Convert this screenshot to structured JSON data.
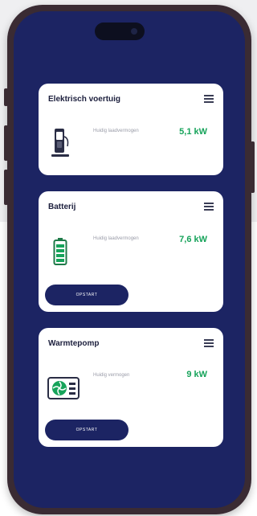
{
  "cards": [
    {
      "title": "Elektrisch voertuig",
      "description": "Huidig laadvermogen",
      "value": "5,1 kW",
      "icon": "ev-charger-icon",
      "button": ""
    },
    {
      "title": "Batterij",
      "description": "Huidig laadvermogen",
      "value": "7,6 kW",
      "icon": "battery-icon",
      "button": "OPSTART"
    },
    {
      "title": "Warmtepomp",
      "description": "Huidig vermogen",
      "value": "9 kW",
      "icon": "heat-pump-icon",
      "button": "OPSTART"
    }
  ],
  "colors": {
    "screen_background": "#1c2463",
    "value_green": "#16a35a",
    "button_navy": "#1c2463"
  }
}
